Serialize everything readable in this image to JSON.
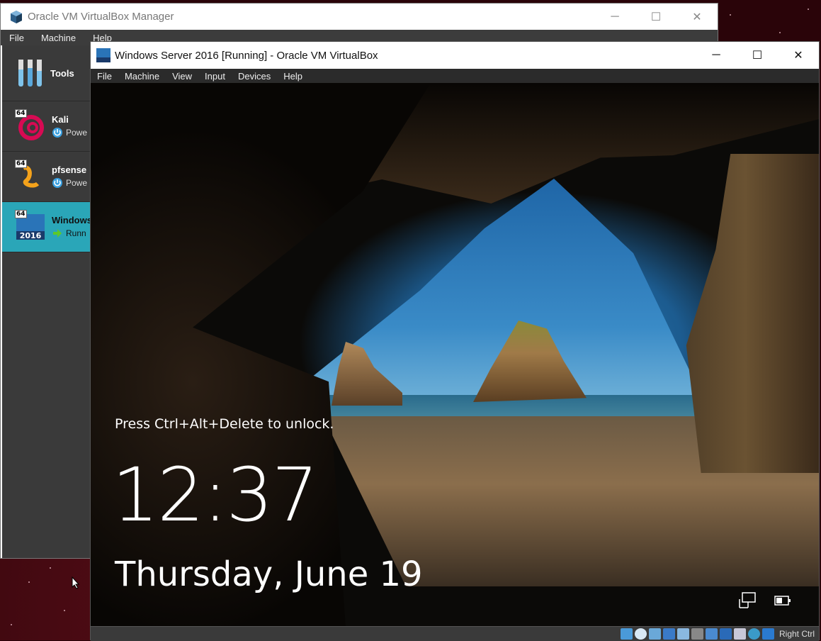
{
  "manager": {
    "title": "Oracle VM VirtualBox Manager",
    "menu": [
      "File",
      "Machine",
      "Help"
    ],
    "window_controls": {
      "minimize": "─",
      "maximize": "☐",
      "close": "✕"
    },
    "tools_label": "Tools",
    "vms": [
      {
        "name": "Kali",
        "state": "Powe",
        "state_icon": "power-off-icon",
        "badge": "64",
        "selected": false
      },
      {
        "name": "pfsense",
        "state": "Powe",
        "state_icon": "power-off-icon",
        "badge": "64",
        "selected": false
      },
      {
        "name": "Windows",
        "state": "Runn",
        "state_icon": "running-arrow-icon",
        "badge": "64",
        "year": "2016",
        "selected": true
      }
    ]
  },
  "vm_window": {
    "title": "Windows Server 2016 [Running] - Oracle VM VirtualBox",
    "menu": [
      "File",
      "Machine",
      "View",
      "Input",
      "Devices",
      "Help"
    ],
    "window_controls": {
      "minimize": "─",
      "maximize": "☐",
      "close": "✕"
    },
    "lock_screen": {
      "unlock_hint": "Press Ctrl+Alt+Delete to unlock.",
      "time": "12:37",
      "date": "Thursday, June 19"
    },
    "statusbar": {
      "host_key": "Right Ctrl"
    }
  },
  "colors": {
    "selected_vm": "#2aa6b8",
    "sidebar": "#3a3a3a",
    "menubar": "#2b2b2b"
  }
}
